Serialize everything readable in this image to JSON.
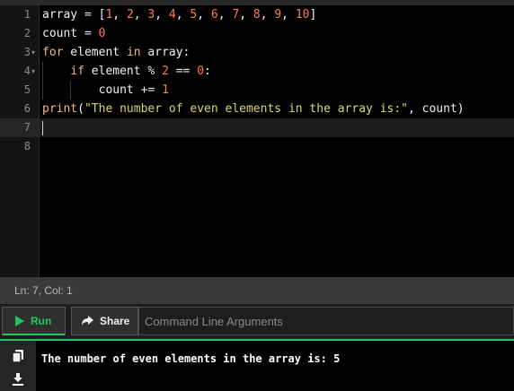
{
  "editor": {
    "line_numbers": [
      "1",
      "2",
      "3",
      "4",
      "5",
      "6",
      "7",
      "8"
    ],
    "fold_markers": [
      "▾",
      "▾"
    ],
    "lines": [
      [
        {
          "t": "array",
          "c": "plain"
        },
        {
          "t": " = ",
          "c": "op"
        },
        {
          "t": "[",
          "c": "plain"
        },
        {
          "t": "1",
          "c": "num"
        },
        {
          "t": ", ",
          "c": "plain"
        },
        {
          "t": "2",
          "c": "num"
        },
        {
          "t": ", ",
          "c": "plain"
        },
        {
          "t": "3",
          "c": "num"
        },
        {
          "t": ", ",
          "c": "plain"
        },
        {
          "t": "4",
          "c": "num"
        },
        {
          "t": ", ",
          "c": "plain"
        },
        {
          "t": "5",
          "c": "num"
        },
        {
          "t": ", ",
          "c": "plain"
        },
        {
          "t": "6",
          "c": "num"
        },
        {
          "t": ", ",
          "c": "plain"
        },
        {
          "t": "7",
          "c": "num"
        },
        {
          "t": ", ",
          "c": "plain"
        },
        {
          "t": "8",
          "c": "num"
        },
        {
          "t": ", ",
          "c": "plain"
        },
        {
          "t": "9",
          "c": "num"
        },
        {
          "t": ", ",
          "c": "plain"
        },
        {
          "t": "10",
          "c": "num"
        },
        {
          "t": "]",
          "c": "plain"
        }
      ],
      [
        {
          "t": "count",
          "c": "plain"
        },
        {
          "t": " = ",
          "c": "op"
        },
        {
          "t": "0",
          "c": "num"
        }
      ],
      [
        {
          "t": "for",
          "c": "kw"
        },
        {
          "t": " element ",
          "c": "plain"
        },
        {
          "t": "in",
          "c": "kw"
        },
        {
          "t": " array:",
          "c": "plain"
        }
      ],
      [
        {
          "t": "    ",
          "c": "plain"
        },
        {
          "t": "if",
          "c": "kw"
        },
        {
          "t": " element ",
          "c": "plain"
        },
        {
          "t": "%",
          "c": "op"
        },
        {
          "t": " ",
          "c": "plain"
        },
        {
          "t": "2",
          "c": "num"
        },
        {
          "t": " == ",
          "c": "op"
        },
        {
          "t": "0",
          "c": "num"
        },
        {
          "t": ":",
          "c": "plain"
        }
      ],
      [
        {
          "t": "        count ",
          "c": "plain"
        },
        {
          "t": "+=",
          "c": "op"
        },
        {
          "t": " ",
          "c": "plain"
        },
        {
          "t": "1",
          "c": "num"
        }
      ],
      [
        {
          "t": "print",
          "c": "kw"
        },
        {
          "t": "(",
          "c": "plain"
        },
        {
          "t": "\"The number of even elements in the array is:\"",
          "c": "str"
        },
        {
          "t": ", count)",
          "c": "plain"
        }
      ],
      [],
      []
    ]
  },
  "status_bar": {
    "position": "Ln: 7,  Col: 1"
  },
  "toolbar": {
    "run_label": "Run",
    "share_label": "Share",
    "command_placeholder": "Command Line Arguments"
  },
  "output": {
    "text": "The number of even elements in the array is: 5",
    "icons": [
      "copy-icon",
      "download-icon"
    ]
  },
  "colors": {
    "accent_green": "#22c55e",
    "keyword": "#f5b97a",
    "number": "#ff7a4d",
    "string": "#d8d86a"
  }
}
